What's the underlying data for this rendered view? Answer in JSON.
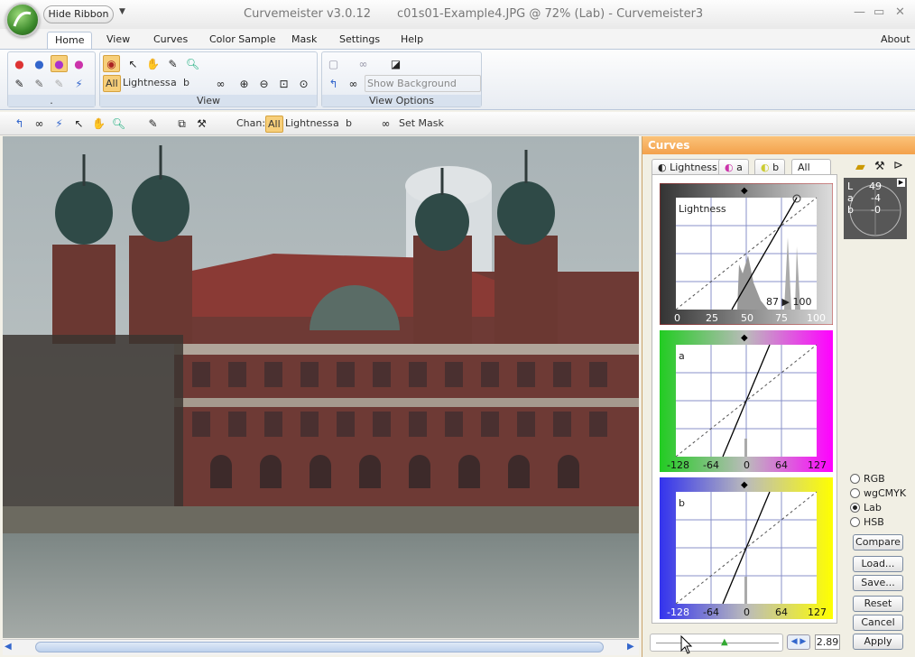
{
  "app": {
    "hide_ribbon": "Hide Ribbon",
    "title_app": "Curvemeister v3.0.12",
    "title_doc": "c01s01-Example4.JPG @ 72% (Lab) - Curvemeister3",
    "min": "—",
    "max": "▭",
    "close": "✕"
  },
  "menu_tabs": [
    "Home",
    "View",
    "Curves",
    "Color Sample",
    "Mask",
    "Settings",
    "Help"
  ],
  "about": "About",
  "ribbon": {
    "group_view_label": "View",
    "group_viewopts_label": "View Options",
    "group_first_label": ".",
    "chan_all": "All",
    "chan_lightness": "Lightness",
    "chan_a": "a",
    "chan_b": "b",
    "show_bg_layers": "Show Background Layers"
  },
  "toolbar": {
    "chan_label": "Chan:",
    "all": "All",
    "lightness": "Lightness",
    "a": "a",
    "b": "b",
    "set_mask": "Set Mask"
  },
  "panel": {
    "title": "Curves",
    "tabs": [
      "Lightness",
      "a",
      "b",
      "All"
    ],
    "lightness_label": "Lightness",
    "lightness_readout": "87 ▶ 100",
    "lightness_ticks": [
      "0",
      "25",
      "50",
      "75",
      "100"
    ],
    "a_label": "a",
    "a_ticks": [
      "-128",
      "-64",
      "0",
      "64",
      "127"
    ],
    "b_label": "b",
    "b_ticks": [
      "-128",
      "-64",
      "0",
      "64",
      "127"
    ],
    "lab_L": "L",
    "lab_L_val": "49",
    "lab_a": "a",
    "lab_a_val": "-4",
    "lab_b": "b",
    "lab_b_val": "-0",
    "modes": [
      "RGB",
      "wgCMYK",
      "Lab",
      "HSB"
    ],
    "selected_mode": "Lab",
    "buttons": [
      "Compare",
      "Load...",
      "Save...",
      "Reset",
      "Cancel",
      "Apply"
    ],
    "slider_value": "2.89"
  },
  "colors": {
    "accent": "#f3a14b",
    "a_channel": "#ff00ff",
    "b_channel": "#ffff00"
  }
}
